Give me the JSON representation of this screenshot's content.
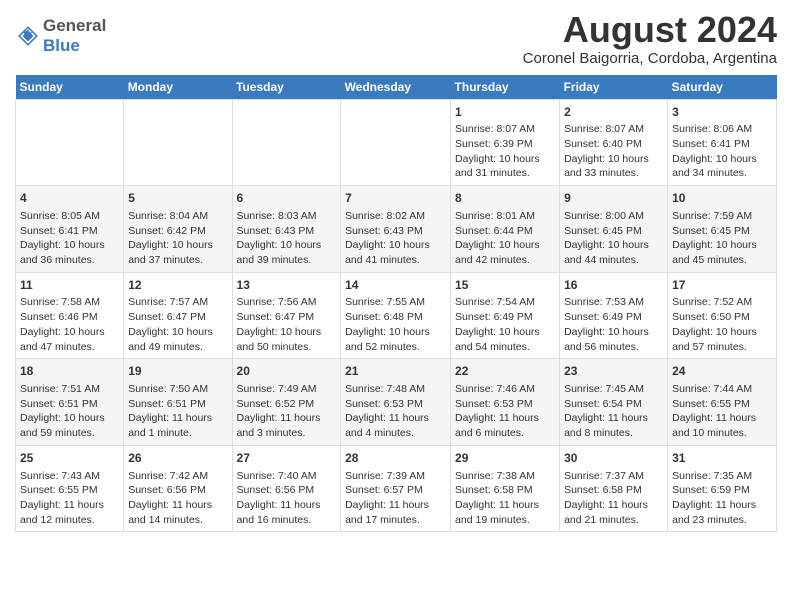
{
  "logo": {
    "general": "General",
    "blue": "Blue"
  },
  "title": "August 2024",
  "subtitle": "Coronel Baigorria, Cordoba, Argentina",
  "days_of_week": [
    "Sunday",
    "Monday",
    "Tuesday",
    "Wednesday",
    "Thursday",
    "Friday",
    "Saturday"
  ],
  "weeks": [
    [
      {
        "day": "",
        "info": ""
      },
      {
        "day": "",
        "info": ""
      },
      {
        "day": "",
        "info": ""
      },
      {
        "day": "",
        "info": ""
      },
      {
        "day": "1",
        "info": "Sunrise: 8:07 AM\nSunset: 6:39 PM\nDaylight: 10 hours and 31 minutes."
      },
      {
        "day": "2",
        "info": "Sunrise: 8:07 AM\nSunset: 6:40 PM\nDaylight: 10 hours and 33 minutes."
      },
      {
        "day": "3",
        "info": "Sunrise: 8:06 AM\nSunset: 6:41 PM\nDaylight: 10 hours and 34 minutes."
      }
    ],
    [
      {
        "day": "4",
        "info": "Sunrise: 8:05 AM\nSunset: 6:41 PM\nDaylight: 10 hours and 36 minutes."
      },
      {
        "day": "5",
        "info": "Sunrise: 8:04 AM\nSunset: 6:42 PM\nDaylight: 10 hours and 37 minutes."
      },
      {
        "day": "6",
        "info": "Sunrise: 8:03 AM\nSunset: 6:43 PM\nDaylight: 10 hours and 39 minutes."
      },
      {
        "day": "7",
        "info": "Sunrise: 8:02 AM\nSunset: 6:43 PM\nDaylight: 10 hours and 41 minutes."
      },
      {
        "day": "8",
        "info": "Sunrise: 8:01 AM\nSunset: 6:44 PM\nDaylight: 10 hours and 42 minutes."
      },
      {
        "day": "9",
        "info": "Sunrise: 8:00 AM\nSunset: 6:45 PM\nDaylight: 10 hours and 44 minutes."
      },
      {
        "day": "10",
        "info": "Sunrise: 7:59 AM\nSunset: 6:45 PM\nDaylight: 10 hours and 45 minutes."
      }
    ],
    [
      {
        "day": "11",
        "info": "Sunrise: 7:58 AM\nSunset: 6:46 PM\nDaylight: 10 hours and 47 minutes."
      },
      {
        "day": "12",
        "info": "Sunrise: 7:57 AM\nSunset: 6:47 PM\nDaylight: 10 hours and 49 minutes."
      },
      {
        "day": "13",
        "info": "Sunrise: 7:56 AM\nSunset: 6:47 PM\nDaylight: 10 hours and 50 minutes."
      },
      {
        "day": "14",
        "info": "Sunrise: 7:55 AM\nSunset: 6:48 PM\nDaylight: 10 hours and 52 minutes."
      },
      {
        "day": "15",
        "info": "Sunrise: 7:54 AM\nSunset: 6:49 PM\nDaylight: 10 hours and 54 minutes."
      },
      {
        "day": "16",
        "info": "Sunrise: 7:53 AM\nSunset: 6:49 PM\nDaylight: 10 hours and 56 minutes."
      },
      {
        "day": "17",
        "info": "Sunrise: 7:52 AM\nSunset: 6:50 PM\nDaylight: 10 hours and 57 minutes."
      }
    ],
    [
      {
        "day": "18",
        "info": "Sunrise: 7:51 AM\nSunset: 6:51 PM\nDaylight: 10 hours and 59 minutes."
      },
      {
        "day": "19",
        "info": "Sunrise: 7:50 AM\nSunset: 6:51 PM\nDaylight: 11 hours and 1 minute."
      },
      {
        "day": "20",
        "info": "Sunrise: 7:49 AM\nSunset: 6:52 PM\nDaylight: 11 hours and 3 minutes."
      },
      {
        "day": "21",
        "info": "Sunrise: 7:48 AM\nSunset: 6:53 PM\nDaylight: 11 hours and 4 minutes."
      },
      {
        "day": "22",
        "info": "Sunrise: 7:46 AM\nSunset: 6:53 PM\nDaylight: 11 hours and 6 minutes."
      },
      {
        "day": "23",
        "info": "Sunrise: 7:45 AM\nSunset: 6:54 PM\nDaylight: 11 hours and 8 minutes."
      },
      {
        "day": "24",
        "info": "Sunrise: 7:44 AM\nSunset: 6:55 PM\nDaylight: 11 hours and 10 minutes."
      }
    ],
    [
      {
        "day": "25",
        "info": "Sunrise: 7:43 AM\nSunset: 6:55 PM\nDaylight: 11 hours and 12 minutes."
      },
      {
        "day": "26",
        "info": "Sunrise: 7:42 AM\nSunset: 6:56 PM\nDaylight: 11 hours and 14 minutes."
      },
      {
        "day": "27",
        "info": "Sunrise: 7:40 AM\nSunset: 6:56 PM\nDaylight: 11 hours and 16 minutes."
      },
      {
        "day": "28",
        "info": "Sunrise: 7:39 AM\nSunset: 6:57 PM\nDaylight: 11 hours and 17 minutes."
      },
      {
        "day": "29",
        "info": "Sunrise: 7:38 AM\nSunset: 6:58 PM\nDaylight: 11 hours and 19 minutes."
      },
      {
        "day": "30",
        "info": "Sunrise: 7:37 AM\nSunset: 6:58 PM\nDaylight: 11 hours and 21 minutes."
      },
      {
        "day": "31",
        "info": "Sunrise: 7:35 AM\nSunset: 6:59 PM\nDaylight: 11 hours and 23 minutes."
      }
    ]
  ]
}
